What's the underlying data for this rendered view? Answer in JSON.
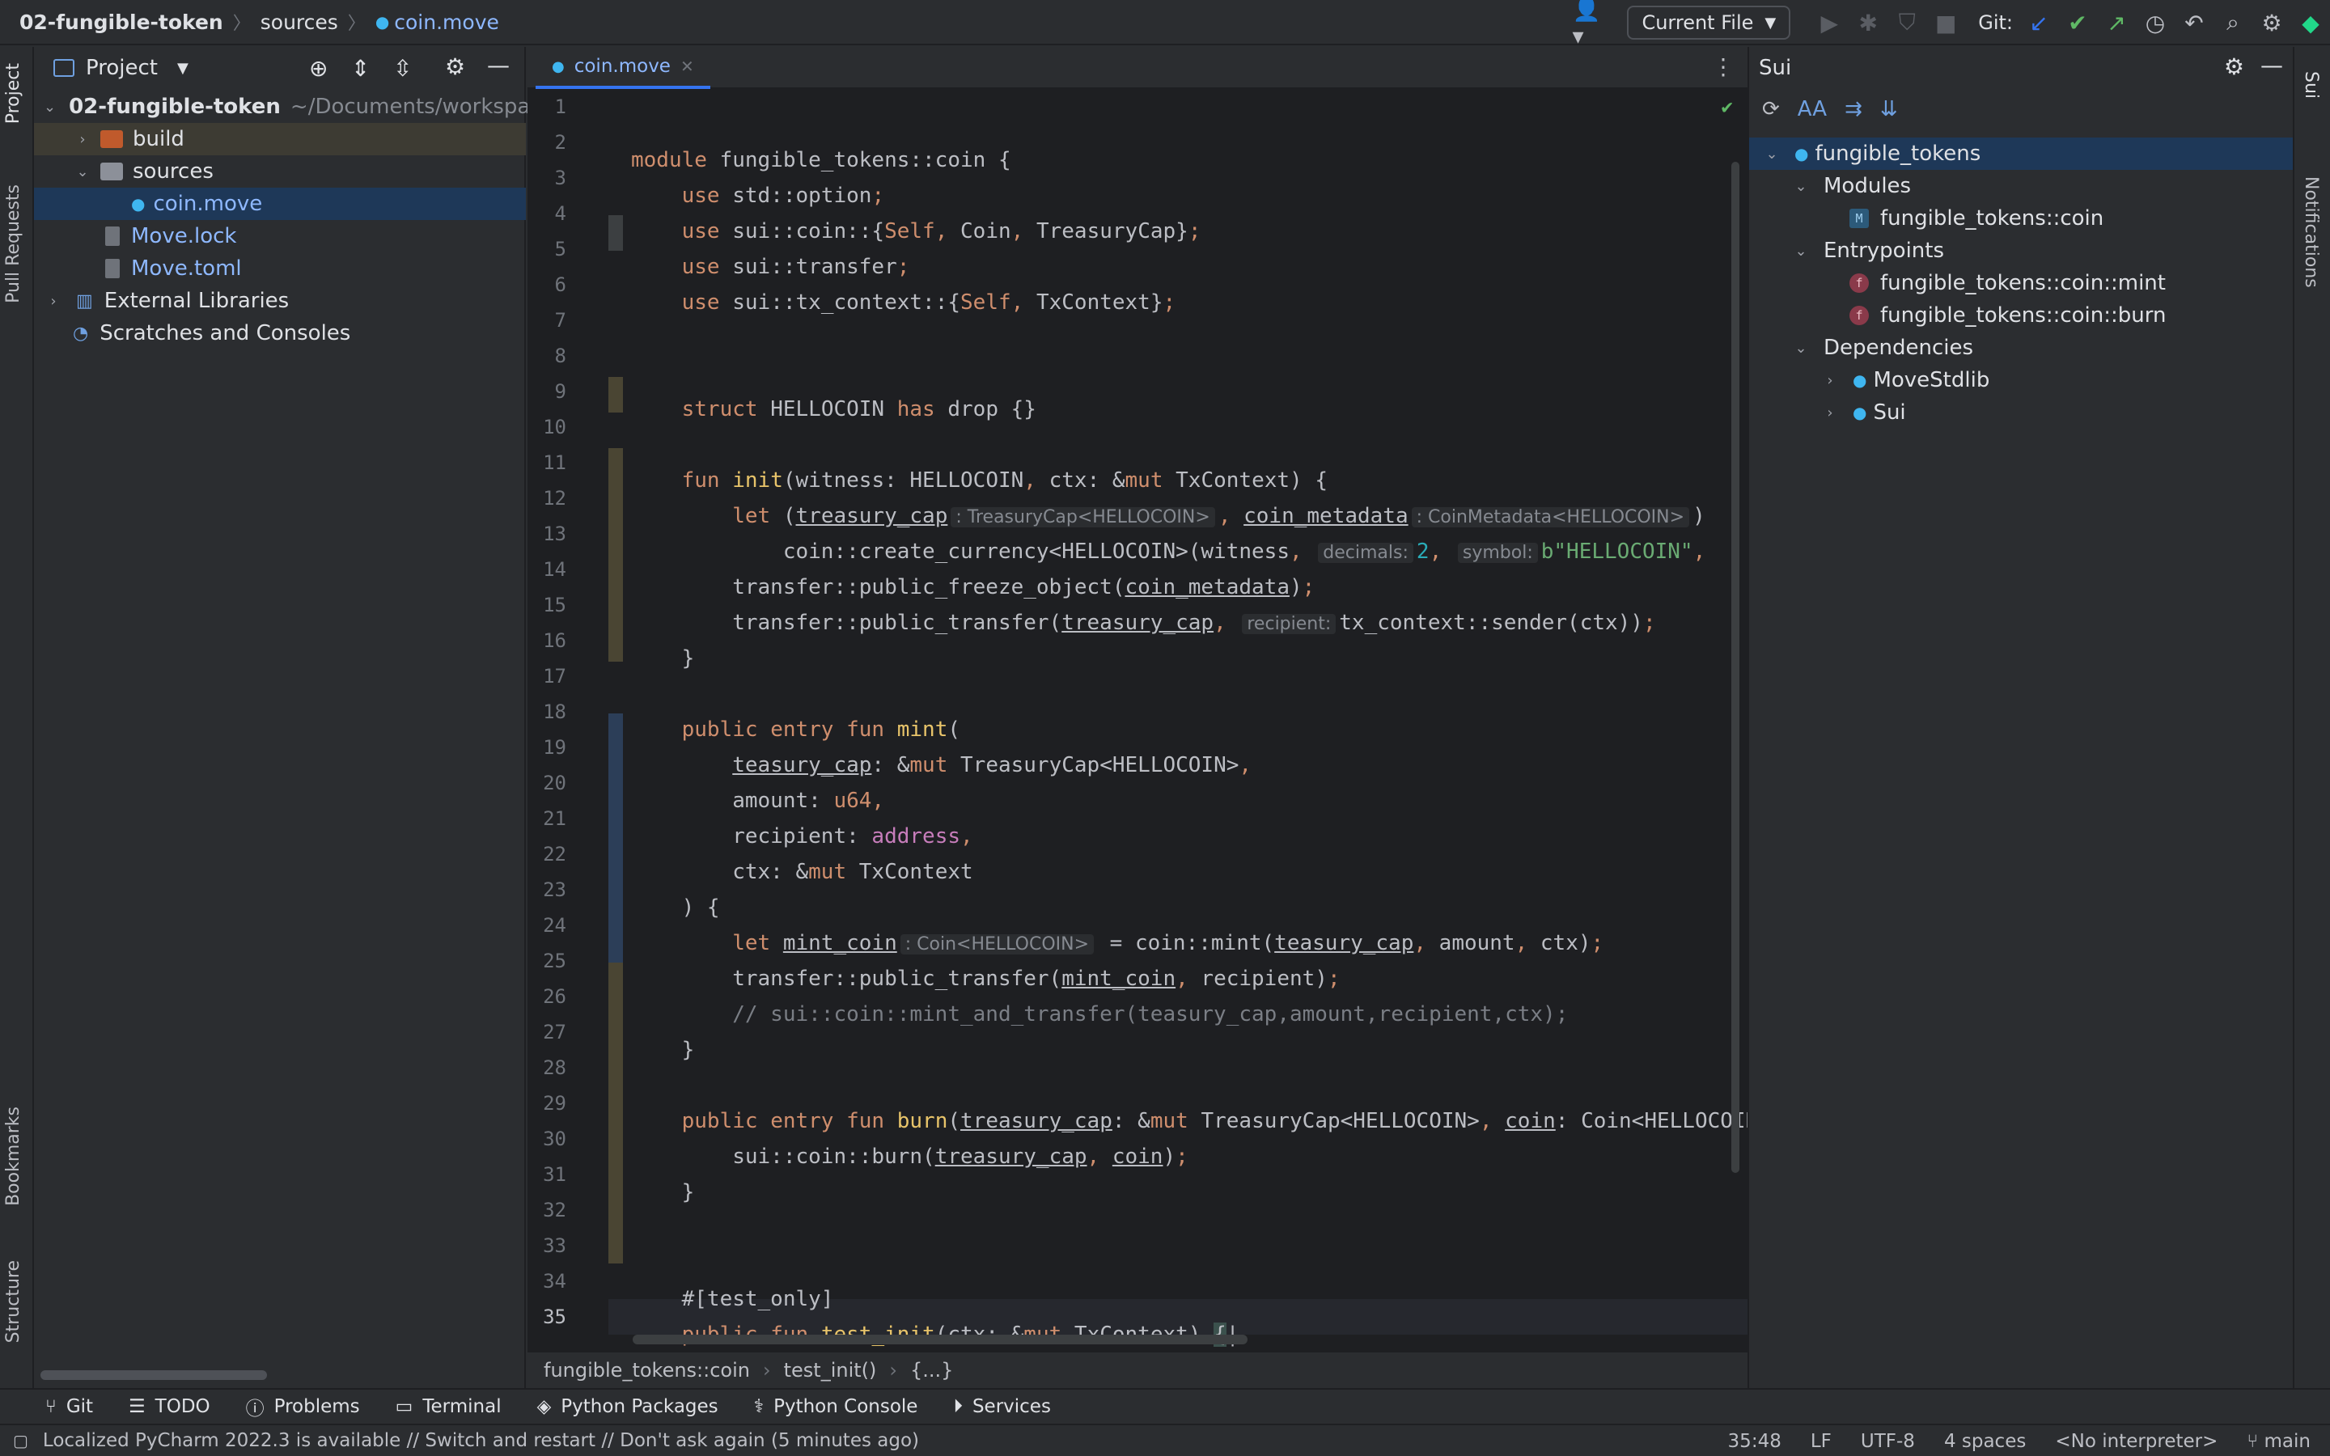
{
  "breadcrumb": {
    "project": "02-fungible-token",
    "folder": "sources",
    "file": "coin.move"
  },
  "toolbar": {
    "run_config": "Current File",
    "git_label": "Git:"
  },
  "project_panel": {
    "title": "Project",
    "items": [
      {
        "label": "02-fungible-token",
        "suffix": "~/Documents/workspa"
      },
      {
        "label": "build"
      },
      {
        "label": "sources"
      },
      {
        "label": "coin.move"
      },
      {
        "label": "Move.lock"
      },
      {
        "label": "Move.toml"
      },
      {
        "label": "External Libraries"
      },
      {
        "label": "Scratches and Consoles"
      }
    ]
  },
  "left_tabs": {
    "project": "Project",
    "pull_requests": "Pull Requests",
    "bookmarks": "Bookmarks",
    "structure": "Structure"
  },
  "right_tabs": {
    "sui": "Sui",
    "notifications": "Notifications"
  },
  "editor": {
    "tab": "coin.move",
    "line_numbers": [
      "1",
      "2",
      "3",
      "4",
      "5",
      "6",
      "7",
      "8",
      "9",
      "10",
      "11",
      "12",
      "13",
      "14",
      "15",
      "16",
      "17",
      "18",
      "19",
      "20",
      "21",
      "22",
      "23",
      "24",
      "25",
      "26",
      "27",
      "28",
      "29",
      "30",
      "31",
      "32",
      "33",
      "34",
      "35"
    ],
    "hints": {
      "treasury_cap_type": ": TreasuryCap<HELLOCOIN>",
      "coin_metadata_type": ": CoinMetadata<HELLOCOIN>",
      "decimals": "decimals:",
      "symbol": "symbol:",
      "recipient": "recipient:",
      "mint_coin_type": ": Coin<HELLOCOIN>"
    }
  },
  "code_breadcrumb": [
    "fungible_tokens::coin",
    "test_init()",
    "{...}"
  ],
  "sui_panel": {
    "title": "Sui",
    "root": "fungible_tokens",
    "modules_label": "Modules",
    "modules": [
      "fungible_tokens::coin"
    ],
    "entrypoints_label": "Entrypoints",
    "entrypoints": [
      "fungible_tokens::coin::mint",
      "fungible_tokens::coin::burn"
    ],
    "dependencies_label": "Dependencies",
    "dependencies": [
      "MoveStdlib",
      "Sui"
    ]
  },
  "bottom_tools": [
    "Git",
    "TODO",
    "Problems",
    "Terminal",
    "Python Packages",
    "Python Console",
    "Services"
  ],
  "status": {
    "message": "Localized PyCharm 2022.3 is available // Switch and restart // Don't ask again (5 minutes ago)",
    "position": "35:48",
    "line_sep": "LF",
    "encoding": "UTF-8",
    "indent": "4 spaces",
    "interpreter": "<No interpreter>",
    "branch": "main"
  },
  "colors": {
    "accent": "#3574f0",
    "keyword": "#cf8e6d",
    "function": "#56a8f5",
    "number": "#2aacb8",
    "string": "#6aab73"
  }
}
